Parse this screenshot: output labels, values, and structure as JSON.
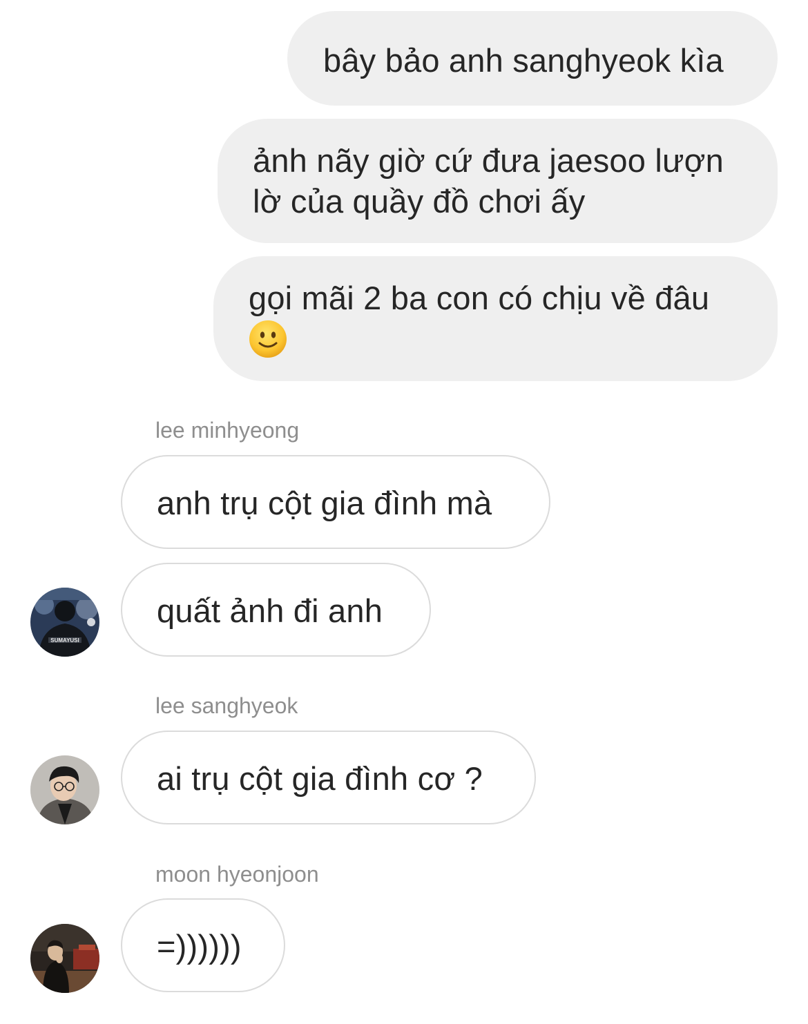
{
  "thread": {
    "outgoing": [
      {
        "text": "bây bảo anh sanghyeok kìa"
      },
      {
        "text": "ảnh nãy giờ cứ đưa jaesoo lượn lờ của quầy đồ chơi ấy"
      },
      {
        "text": "gọi mãi 2 ba con có chịu về đâu",
        "emoji": "slightly-smiling-face"
      }
    ],
    "incoming": [
      {
        "sender": "lee minhyeong",
        "avatar": "avatar-jersey-sumayusi",
        "avatar_text": "SUMAYUSI",
        "messages": [
          "anh trụ cột gia đình mà",
          "quất ảnh đi anh"
        ]
      },
      {
        "sender": "lee sanghyeok",
        "avatar": "avatar-man-glasses",
        "messages": [
          "ai trụ cột gia đình cơ ?"
        ]
      },
      {
        "sender": "moon hyeonjoon",
        "avatar": "avatar-man-night",
        "messages": [
          "=))))))"
        ]
      }
    ]
  },
  "colors": {
    "outgoing_bubble": "#efefef",
    "incoming_border": "#dbdbdb",
    "text": "#262626",
    "sender_name": "#8e8e8e"
  }
}
